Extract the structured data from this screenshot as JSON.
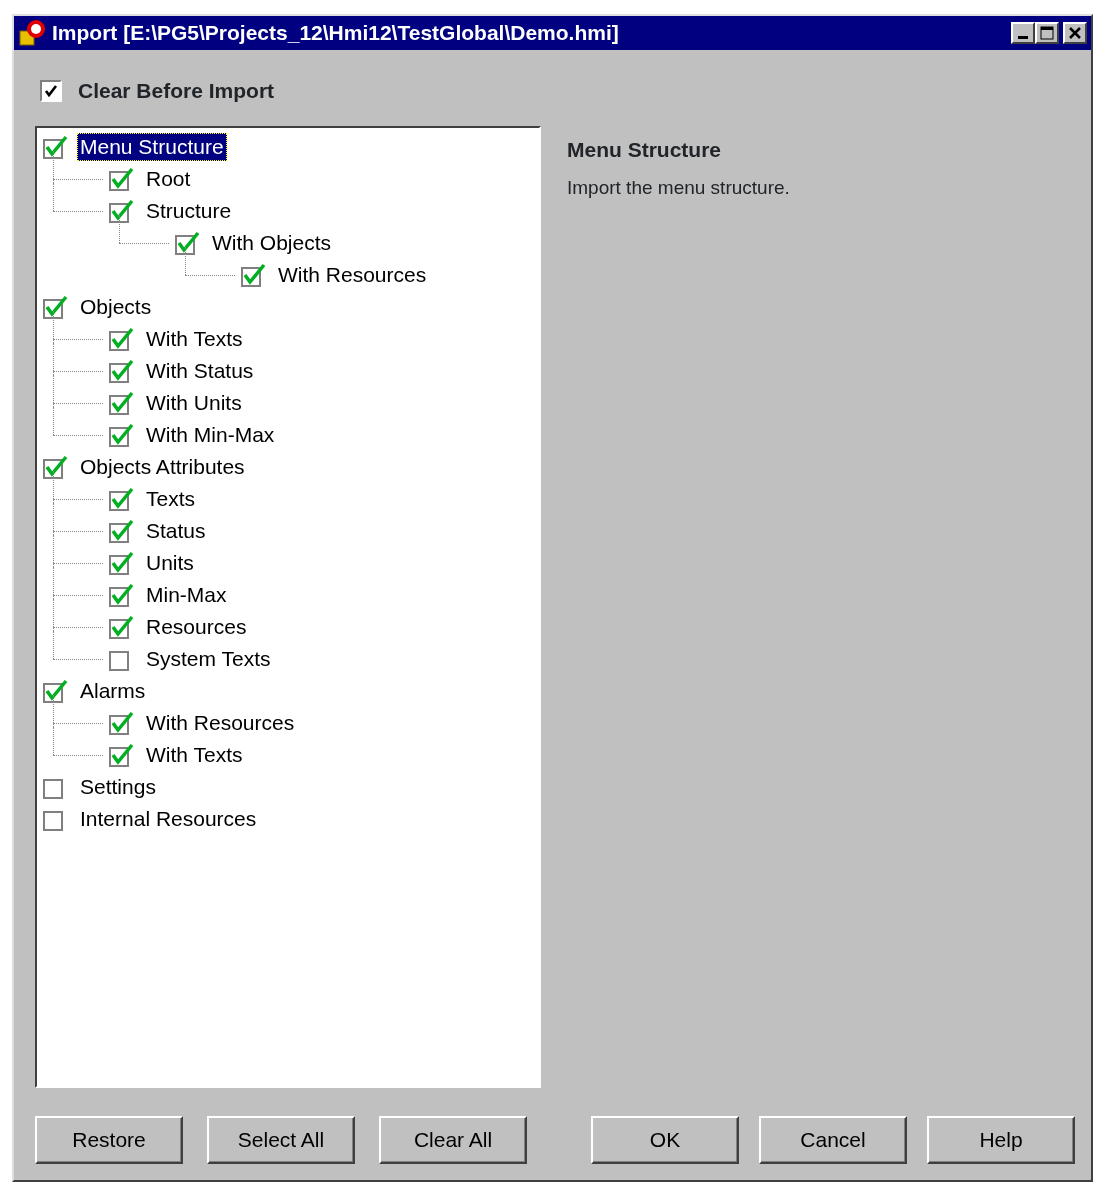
{
  "window": {
    "title": "Import [E:\\PG5\\Projects_12\\Hmi12\\TestGlobal\\Demo.hmi]"
  },
  "clear_before_import": {
    "label": "Clear Before Import",
    "checked": true
  },
  "tree": [
    {
      "label": "Menu Structure",
      "checked": true,
      "selected": true,
      "children": [
        {
          "label": "Root",
          "checked": true,
          "selected": false
        },
        {
          "label": "Structure",
          "checked": true,
          "selected": false,
          "children": [
            {
              "label": "With Objects",
              "checked": true,
              "selected": false,
              "children": [
                {
                  "label": "With Resources",
                  "checked": true,
                  "selected": false
                }
              ]
            }
          ]
        }
      ]
    },
    {
      "label": "Objects",
      "checked": true,
      "selected": false,
      "children": [
        {
          "label": "With Texts",
          "checked": true,
          "selected": false
        },
        {
          "label": "With Status",
          "checked": true,
          "selected": false
        },
        {
          "label": "With Units",
          "checked": true,
          "selected": false
        },
        {
          "label": "With Min-Max",
          "checked": true,
          "selected": false
        }
      ]
    },
    {
      "label": "Objects Attributes",
      "checked": true,
      "selected": false,
      "children": [
        {
          "label": "Texts",
          "checked": true,
          "selected": false
        },
        {
          "label": "Status",
          "checked": true,
          "selected": false
        },
        {
          "label": "Units",
          "checked": true,
          "selected": false
        },
        {
          "label": "Min-Max",
          "checked": true,
          "selected": false
        },
        {
          "label": "Resources",
          "checked": true,
          "selected": false
        },
        {
          "label": "System Texts",
          "checked": false,
          "selected": false
        }
      ]
    },
    {
      "label": "Alarms",
      "checked": true,
      "selected": false,
      "children": [
        {
          "label": "With Resources",
          "checked": true,
          "selected": false
        },
        {
          "label": "With Texts",
          "checked": true,
          "selected": false
        }
      ]
    },
    {
      "label": "Settings",
      "checked": false,
      "selected": false
    },
    {
      "label": "Internal Resources",
      "checked": false,
      "selected": false
    }
  ],
  "description": {
    "title": "Menu Structure",
    "text": "Import the menu structure."
  },
  "buttons_left": [
    "Restore",
    "Select All",
    "Clear All"
  ],
  "buttons_right": [
    "OK",
    "Cancel",
    "Help"
  ]
}
